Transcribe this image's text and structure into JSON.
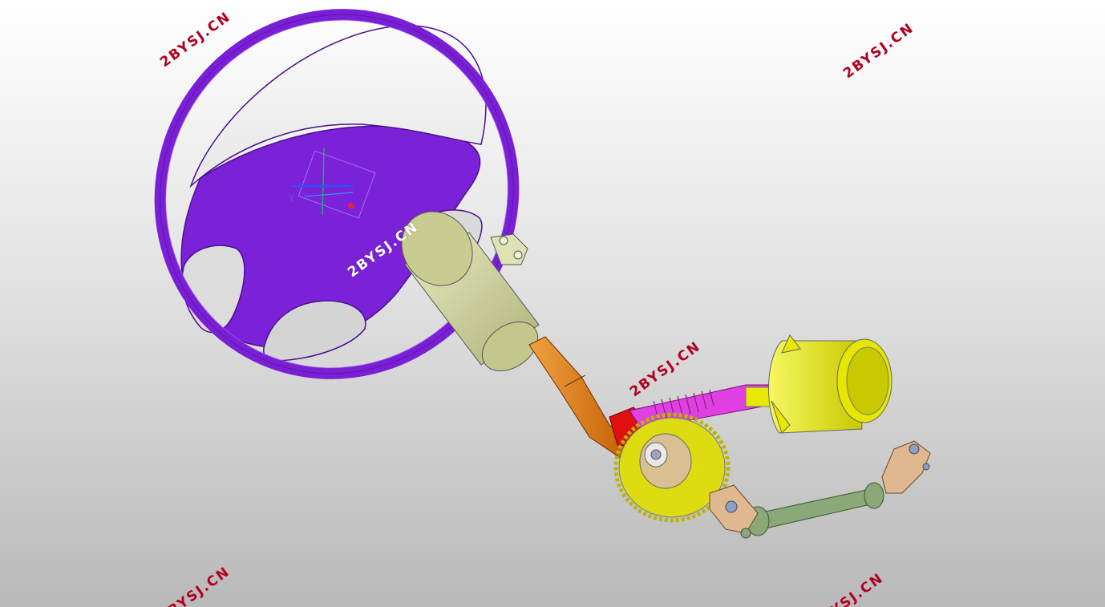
{
  "watermarks": [
    {
      "text": "2BYSJ.CN",
      "color": "#b00020"
    },
    {
      "text": "2BYSJ.CN",
      "color": "#b00020"
    },
    {
      "text": "2BYSJ.CN",
      "color": "#ffffff"
    },
    {
      "text": "2BYSJ.CN",
      "color": "#b00020"
    },
    {
      "text": "2BYSJ.CN",
      "color": "#b00020"
    },
    {
      "text": "2BYSJ.CN",
      "color": "#b00020"
    }
  ],
  "axis": {
    "y_label": "Y"
  },
  "colors": {
    "steering_wheel": "#7a1fd6",
    "column_housing": "#cfd2a0",
    "steering_shaft": "#e07b14",
    "motor": "#e8e800",
    "worm_shaft": "#e040e0",
    "worm_gear": "#d9d900",
    "intermediate_shaft": "#8aa878",
    "universal_joint": "#e0b890",
    "clamp": "#e01010"
  }
}
